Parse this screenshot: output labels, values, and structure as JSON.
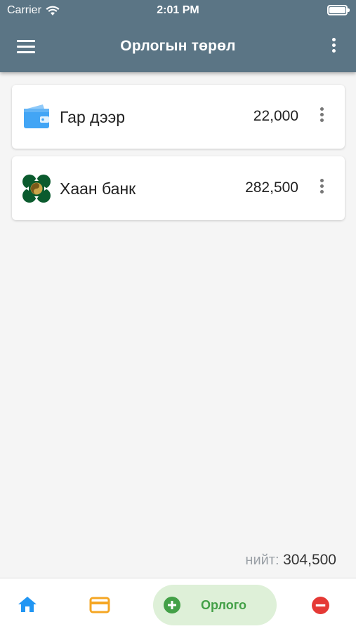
{
  "status": {
    "carrier": "Carrier",
    "time": "2:01 PM"
  },
  "header": {
    "title": "Орлогын төрөл"
  },
  "accounts": [
    {
      "name": "Гар дээр",
      "amount": "22,000",
      "icon": "wallet-icon"
    },
    {
      "name": "Хаан банк",
      "amount": "282,500",
      "icon": "khan-bank-logo"
    }
  ],
  "total": {
    "label": "нийт:",
    "value": "304,500"
  },
  "bottom_nav": {
    "income_label": "Орлого"
  },
  "colors": {
    "appbar": "#5b7585",
    "wallet": "#42a5f5",
    "bank_green": "#0b5b2e",
    "home": "#2196f3",
    "card": "#f5a623",
    "income": "#43a047",
    "expense": "#e53935"
  }
}
